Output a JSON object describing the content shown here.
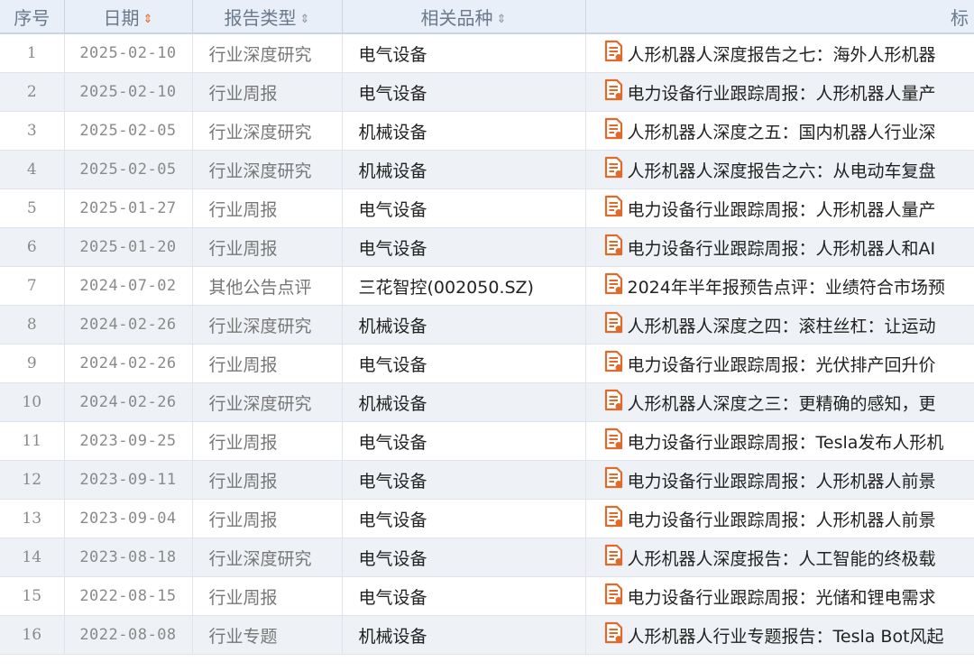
{
  "headers": {
    "num": "序号",
    "date": "日期",
    "type": "报告类型",
    "category": "相关品种",
    "title": "标"
  },
  "sort_glyph": "⇕",
  "colors": {
    "accent": "#e06a2c",
    "header_bg": "#e8eff8",
    "row_alt": "#eef1f5"
  },
  "rows": [
    {
      "num": "1",
      "date": "2025-02-10",
      "type": "行业深度研究",
      "category": "电气设备",
      "title": "人形机器人深度报告之七：海外人形机器"
    },
    {
      "num": "2",
      "date": "2025-02-10",
      "type": "行业周报",
      "category": "电气设备",
      "title": "电力设备行业跟踪周报：人形机器人量产"
    },
    {
      "num": "3",
      "date": "2025-02-05",
      "type": "行业深度研究",
      "category": "机械设备",
      "title": "人形机器人深度之五：国内机器人行业深"
    },
    {
      "num": "4",
      "date": "2025-02-05",
      "type": "行业深度研究",
      "category": "机械设备",
      "title": "人形机器人深度报告之六：从电动车复盘"
    },
    {
      "num": "5",
      "date": "2025-01-27",
      "type": "行业周报",
      "category": "电气设备",
      "title": "电力设备行业跟踪周报：人形机器人量产"
    },
    {
      "num": "6",
      "date": "2025-01-20",
      "type": "行业周报",
      "category": "电气设备",
      "title": "电力设备行业跟踪周报：人形机器人和AI"
    },
    {
      "num": "7",
      "date": "2024-07-02",
      "type": "其他公告点评",
      "category": "三花智控(002050.SZ)",
      "title": "2024年半年报预告点评：业绩符合市场预"
    },
    {
      "num": "8",
      "date": "2024-02-26",
      "type": "行业深度研究",
      "category": "机械设备",
      "title": "人形机器人深度之四：滚柱丝杠：让运动"
    },
    {
      "num": "9",
      "date": "2024-02-26",
      "type": "行业周报",
      "category": "电气设备",
      "title": "电力设备行业跟踪周报：光伏排产回升价"
    },
    {
      "num": "10",
      "date": "2024-02-26",
      "type": "行业深度研究",
      "category": "机械设备",
      "title": "人形机器人深度之三：更精确的感知，更"
    },
    {
      "num": "11",
      "date": "2023-09-25",
      "type": "行业周报",
      "category": "电气设备",
      "title": "电力设备行业跟踪周报：Tesla发布人形机"
    },
    {
      "num": "12",
      "date": "2023-09-11",
      "type": "行业周报",
      "category": "电气设备",
      "title": "电力设备行业跟踪周报：人形机器人前景"
    },
    {
      "num": "13",
      "date": "2023-09-04",
      "type": "行业周报",
      "category": "电气设备",
      "title": "电力设备行业跟踪周报：人形机器人前景"
    },
    {
      "num": "14",
      "date": "2023-08-18",
      "type": "行业深度研究",
      "category": "电气设备",
      "title": "人形机器人深度报告：人工智能的终极载"
    },
    {
      "num": "15",
      "date": "2022-08-15",
      "type": "行业周报",
      "category": "电气设备",
      "title": "电力设备行业跟踪周报：光储和锂电需求"
    },
    {
      "num": "16",
      "date": "2022-08-08",
      "type": "行业专题",
      "category": "机械设备",
      "title": "人形机器人行业专题报告：Tesla Bot风起"
    }
  ]
}
